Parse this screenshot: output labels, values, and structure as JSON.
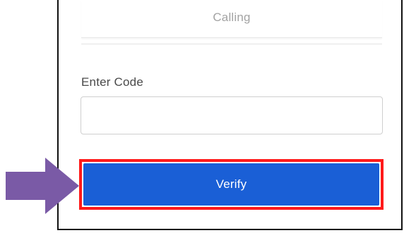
{
  "verification": {
    "calling_label": "Calling",
    "code_label": "Enter Code",
    "code_value": "",
    "code_placeholder": "",
    "verify_label": "Verify"
  },
  "annotations": {
    "highlight_color": "#ff1a1a",
    "arrow_color": "#7a5aa6",
    "button_color": "#1a5fd6",
    "pointer_icon": "right-arrow-icon"
  }
}
